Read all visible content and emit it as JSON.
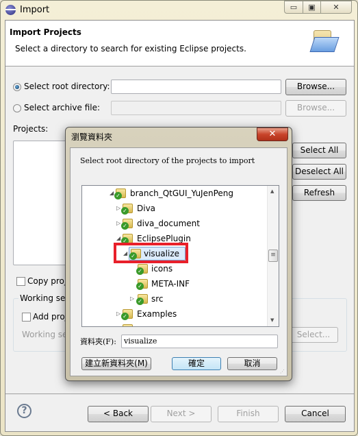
{
  "window": {
    "title": "Import",
    "minimize": "▭",
    "maximize": "▣",
    "close": "✕"
  },
  "header": {
    "title": "Import Projects",
    "description": "Select a directory to search for existing Eclipse projects."
  },
  "source": {
    "root_label": "Select root directory:",
    "root_value": "",
    "root_browse": "Browse...",
    "archive_label": "Select archive file:",
    "archive_value": "",
    "archive_browse": "Browse...",
    "selected": "root"
  },
  "projects": {
    "label": "Projects:",
    "select_all": "Select All",
    "deselect_all": "Deselect All",
    "refresh": "Refresh"
  },
  "options": {
    "copy_label": "Copy proj",
    "working_sets_label": "Working set",
    "add_label": "Add proj",
    "working_sets_field_label": "Working se",
    "select_button": "Select..."
  },
  "footer": {
    "help": "?",
    "back": "< Back",
    "next": "Next >",
    "finish": "Finish",
    "cancel": "Cancel"
  },
  "browse_dialog": {
    "title": "瀏覽資料夾",
    "close": "✕",
    "instruction": "Select root directory of the projects to import",
    "tree": [
      {
        "label": "branch_QtGUI_YuJenPeng",
        "level": 0,
        "expanded": true
      },
      {
        "label": "Diva",
        "level": 1,
        "expanded": false
      },
      {
        "label": "diva_document",
        "level": 1,
        "expanded": false
      },
      {
        "label": "EclipsePlugin",
        "level": 1,
        "expanded": true
      },
      {
        "label": "visualize",
        "level": 2,
        "expanded": true,
        "selected": true
      },
      {
        "label": "icons",
        "level": 3,
        "leaf": true
      },
      {
        "label": "META-INF",
        "level": 3,
        "leaf": true
      },
      {
        "label": "src",
        "level": 3,
        "expanded": false
      },
      {
        "label": "Examples",
        "level": 1,
        "expanded": false
      }
    ],
    "folder_label": "資料夾(F):",
    "folder_value": "visualize",
    "new_folder": "建立新資料夾(M)",
    "ok": "確定",
    "cancel": "取消",
    "highlight_color": "#e8202a"
  }
}
